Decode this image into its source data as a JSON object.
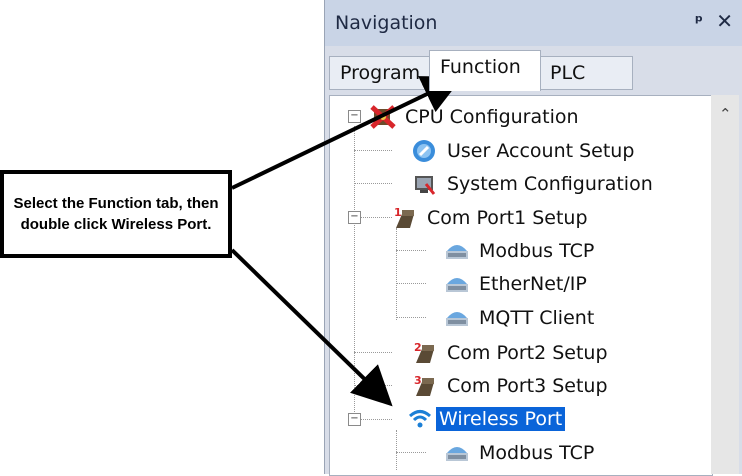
{
  "panel": {
    "title": "Navigation",
    "pin_glyph": "ᵖ",
    "close_glyph": "✕"
  },
  "tabs": [
    {
      "label": "Program",
      "active": false
    },
    {
      "label": "Function",
      "active": true
    },
    {
      "label": "PLC",
      "active": false
    }
  ],
  "tree": {
    "items": [
      {
        "label": "CPU Configuration",
        "icon": "cpu-tools-icon",
        "expanded": true
      },
      {
        "label": "User Account Setup",
        "icon": "user-account-icon"
      },
      {
        "label": "System Configuration",
        "icon": "system-config-icon"
      },
      {
        "label": "Com Port1 Setup",
        "icon": "com-port-1-icon",
        "expanded": true
      },
      {
        "label": "Modbus TCP",
        "icon": "network-icon"
      },
      {
        "label": "EtherNet/IP",
        "icon": "network-icon"
      },
      {
        "label": "MQTT Client",
        "icon": "network-icon"
      },
      {
        "label": "Com Port2 Setup",
        "icon": "com-port-2-icon"
      },
      {
        "label": "Com Port3 Setup",
        "icon": "com-port-3-icon"
      },
      {
        "label": "Wireless Port",
        "icon": "wifi-icon",
        "selected": true,
        "expanded": true
      },
      {
        "label": "Modbus TCP",
        "icon": "network-icon"
      }
    ]
  },
  "callout": {
    "text": "Select the Function tab, then double click Wireless Port."
  },
  "colors": {
    "selection": "#0a64d9",
    "titlebar": "#c9d4e6",
    "panel": "#d8dde8"
  }
}
